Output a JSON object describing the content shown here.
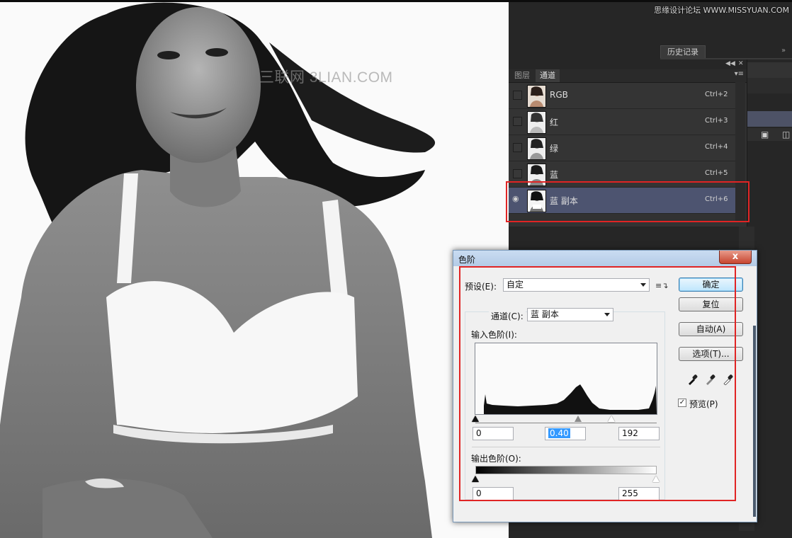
{
  "site_logo": "思缘设计论坛 WWW.MISSYUAN.COM",
  "watermark": "三联网 3LIAN.COM",
  "history_panel": {
    "tab_label": "历史记录",
    "collapse_icon": "double-chevron-right-icon"
  },
  "channels_panel": {
    "tabs": [
      {
        "label": "图层",
        "active": false
      },
      {
        "label": "通道",
        "active": true
      }
    ],
    "channels": [
      {
        "name": "RGB",
        "shortcut": "Ctrl+2",
        "visible": false,
        "selected": false
      },
      {
        "name": "红",
        "shortcut": "Ctrl+3",
        "visible": false,
        "selected": false
      },
      {
        "name": "绿",
        "shortcut": "Ctrl+4",
        "visible": false,
        "selected": false
      },
      {
        "name": "蓝",
        "shortcut": "Ctrl+5",
        "visible": false,
        "selected": false
      },
      {
        "name": "蓝 副本",
        "shortcut": "Ctrl+6",
        "visible": true,
        "selected": true
      }
    ]
  },
  "levels_dialog": {
    "title": "色阶",
    "close_label": "x",
    "preset_label": "预设(E):",
    "preset_value": "自定",
    "channel_label": "通道(C):",
    "channel_value": "蓝 副本",
    "input_levels_label": "输入色阶(I):",
    "input_black": "0",
    "input_gamma": "0.40",
    "input_white": "192",
    "output_levels_label": "输出色阶(O):",
    "output_black": "0",
    "output_white": "255",
    "buttons": {
      "ok": "确定",
      "reset": "复位",
      "auto": "自动(A)",
      "options": "选项(T)..."
    },
    "preview_label": "预览(P)",
    "preview_checked": true
  },
  "colors": {
    "panel_bg": "#323232",
    "selected_row": "#4d5470",
    "highlight_red": "#e02424",
    "default_button": "#bee6fd"
  }
}
